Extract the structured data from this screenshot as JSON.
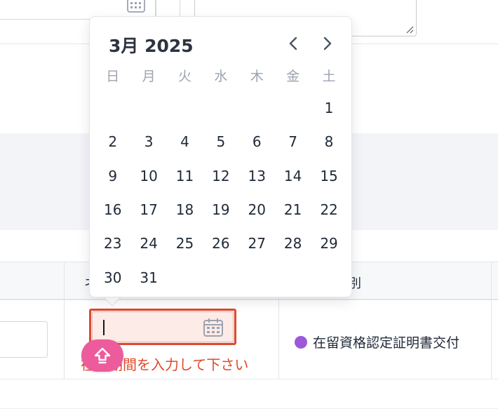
{
  "calendar": {
    "month_label": "3月 2025",
    "weekdays": [
      "日",
      "月",
      "火",
      "水",
      "木",
      "金",
      "土"
    ],
    "days": [
      "",
      "",
      "",
      "",
      "",
      "",
      "1",
      "2",
      "3",
      "4",
      "5",
      "6",
      "7",
      "8",
      "9",
      "10",
      "11",
      "12",
      "13",
      "14",
      "15",
      "16",
      "17",
      "18",
      "19",
      "20",
      "21",
      "22",
      "23",
      "24",
      "25",
      "26",
      "27",
      "28",
      "29",
      "30",
      "31"
    ]
  },
  "table": {
    "header_left_partial": "ネ",
    "header_right_partial": "別"
  },
  "date_field": {
    "value": "",
    "error_message": "在留期間を入力して下さい"
  },
  "status": {
    "label": "在留資格認定証明書交付",
    "color": "#9b59d9"
  },
  "colors": {
    "error": "#dc4a2f",
    "accent_pink": "#ec5b9b"
  }
}
